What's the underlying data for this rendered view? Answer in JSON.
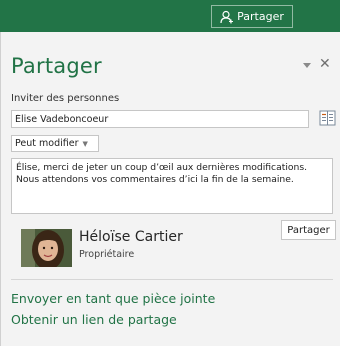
{
  "topbar": {
    "share_label": "Partager"
  },
  "panel": {
    "title": "Partager",
    "invite_label": "Inviter des personnes",
    "invite_value": "Élise Vadeboncoeur",
    "permission": "Peut modifier",
    "message": "Élise, merci de jeter un coup d’œil aux dernières modifications. Nous attendons vos commentaires d’ici la fin de la semaine.",
    "share_button": "Partager",
    "owner": {
      "name": "Héloïse Cartier",
      "role": "Propriétaire"
    },
    "links": {
      "attach": "Envoyer en tant que pièce jointe",
      "get_link": "Obtenir un lien de partage"
    }
  },
  "colors": {
    "accent": "#217346",
    "topbar": "#227447",
    "panel_bg": "#f3f3f3"
  },
  "icons": {
    "top_share": "person-add-icon",
    "pin": "pin-dropdown-icon",
    "close": "close-icon",
    "address_book": "address-book-icon",
    "permission_arrow": "chevron-down-icon"
  }
}
